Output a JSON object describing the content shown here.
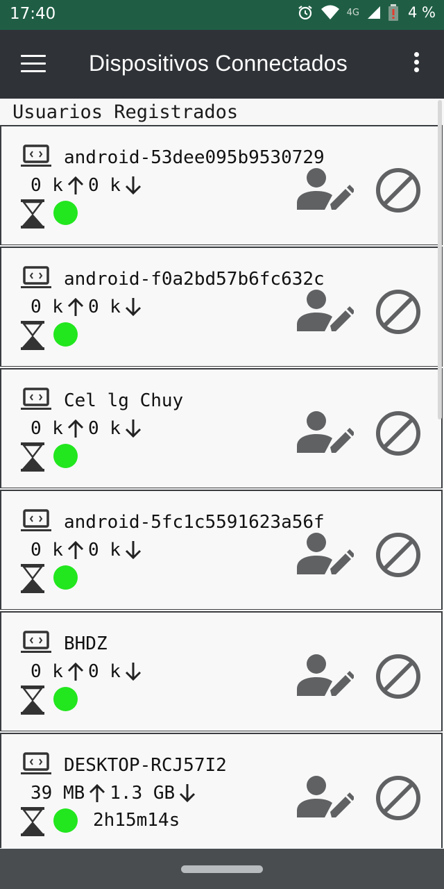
{
  "status_bar": {
    "time": "17:40",
    "network": "4G",
    "battery": "4 %",
    "icons": [
      "alarm-icon",
      "wifi-icon",
      "signal-icon",
      "battery-icon"
    ]
  },
  "app_bar": {
    "title": "Dispositivos Connectados",
    "icons": [
      "menu-icon",
      "more-vert-icon"
    ]
  },
  "section": {
    "title": "Usuarios Registrados"
  },
  "devices": [
    {
      "name": "android-53dee095b9530729",
      "up": "0 k",
      "down": "0 k",
      "duration": ""
    },
    {
      "name": "android-f0a2bd57b6fc632c",
      "up": "0 k",
      "down": "0 k",
      "duration": ""
    },
    {
      "name": "Cel  lg Chuy",
      "up": "0 k",
      "down": "0 k",
      "duration": ""
    },
    {
      "name": "android-5fc1c5591623a56f",
      "up": "0 k",
      "down": "0 k",
      "duration": ""
    },
    {
      "name": "BHDZ",
      "up": "0 k",
      "down": "0 k",
      "duration": ""
    },
    {
      "name": "DESKTOP-RCJ57I2",
      "up": "39 MB",
      "down": "1.3 GB",
      "duration": "2h15m14s"
    }
  ],
  "device_icons": [
    "laptop-icon",
    "arrow-up-icon",
    "arrow-down-icon",
    "hourglass-icon",
    "online-status-dot",
    "edit-user-icon",
    "block-icon"
  ],
  "colors": {
    "status_bar": "#1f5e45",
    "app_bar": "#2f3337",
    "online_dot": "#22e61e",
    "icon_gray": "#5f6163",
    "nav_bar": "#4a4d50"
  }
}
